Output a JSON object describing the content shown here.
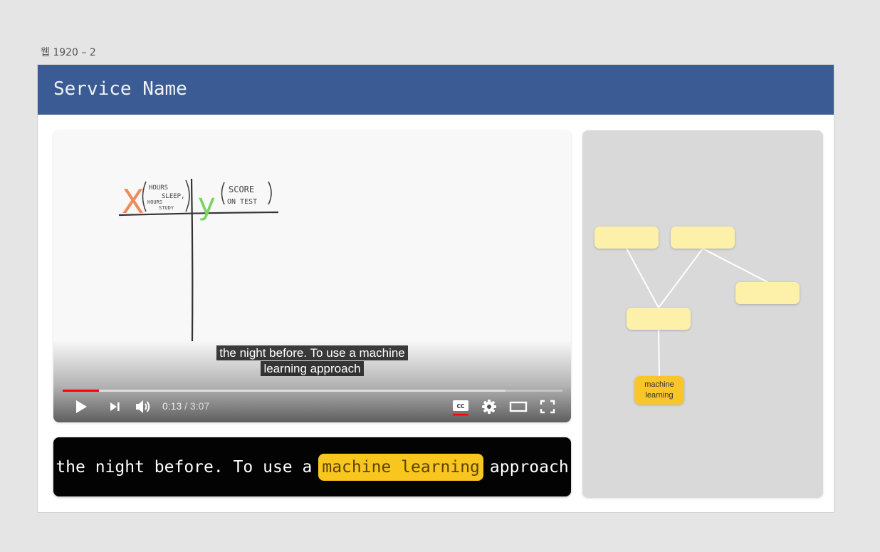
{
  "frame": {
    "label": "웹 1920 – 2"
  },
  "header": {
    "service_name": "Service Name"
  },
  "video": {
    "board": {
      "x_var": "X",
      "x_desc": [
        "HOURS",
        "SLEEP,",
        "HOURS",
        "STUDY"
      ],
      "y_var": "y",
      "y_desc": [
        "SCORE",
        "ON TEST"
      ]
    },
    "captions": [
      "the night before. To use a machine",
      "learning approach"
    ],
    "progress": {
      "played_fraction": 0.073,
      "loaded_fraction": 0.886
    },
    "time": {
      "current": "0:13",
      "separator": " / ",
      "duration": "3:07"
    },
    "controls": {
      "play": "play-icon",
      "next": "next-icon",
      "volume": "volume-icon",
      "cc": "cc-icon",
      "settings": "gear-icon",
      "theater": "theater-mode-icon",
      "fullscreen": "fullscreen-icon"
    }
  },
  "transcript": {
    "before": "the night before. To use a",
    "keyword": "machine learning",
    "after": "approach"
  },
  "concept_map": {
    "main_node": "machine learning",
    "colors": {
      "node": "#fdf0a8",
      "main": "#f9c62a",
      "link": "#ffffff"
    }
  },
  "colors": {
    "header": "#3b5b94",
    "progress": "#ff0000",
    "keyword": "#f9c61f"
  }
}
